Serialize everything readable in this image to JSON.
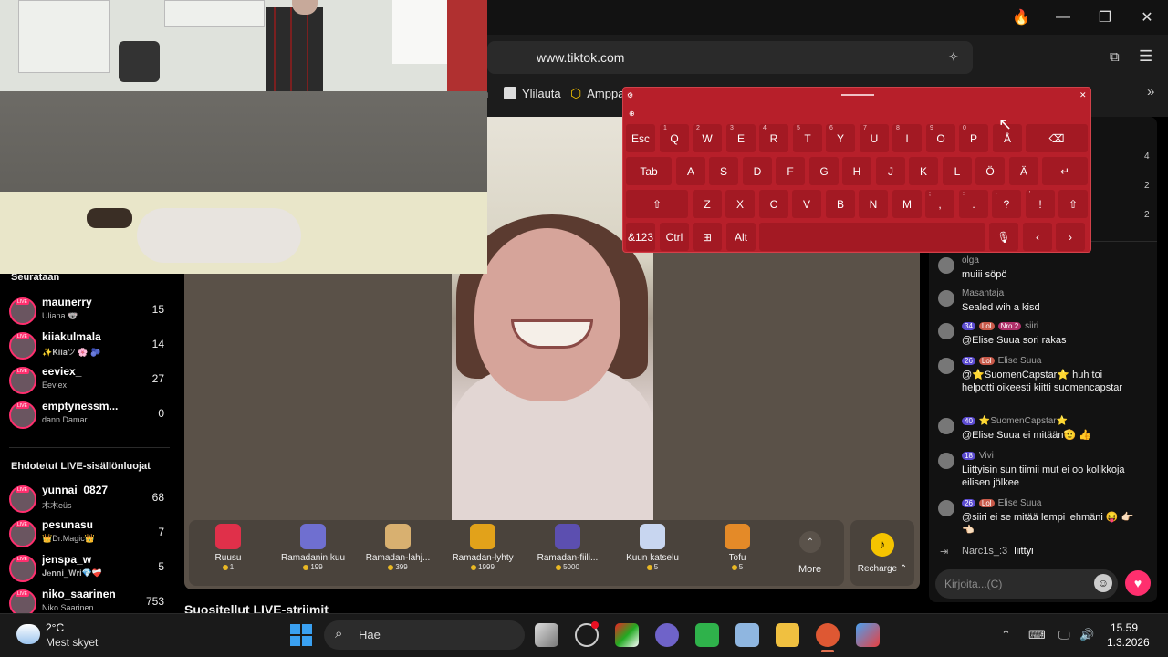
{
  "browser": {
    "url": "www.tiktok.com",
    "bookmarks": [
      {
        "label": "Ylilauta"
      },
      {
        "label": "Amppa"
      }
    ]
  },
  "sidebar": {
    "following_title": "Seurataan",
    "following": [
      {
        "name": "maunerry",
        "sub": "Uliana 🐨",
        "count": "15"
      },
      {
        "name": "kiiakulmala",
        "sub": "✨𝐊𝐢𝐢𝐚ツ 🌸 🫐",
        "count": "14"
      },
      {
        "name": "eeviex_",
        "sub": "Eeviex",
        "count": "27"
      },
      {
        "name": "emptynessm...",
        "sub": "dann Damar",
        "count": "0"
      }
    ],
    "suggested_title": "Ehdotetut LIVE-sisällönluojat",
    "suggested": [
      {
        "name": "yunnai_0827",
        "sub": "木木eüs",
        "count": "68"
      },
      {
        "name": "pesunasu",
        "sub": "👑Dr.Magic👑",
        "count": "7"
      },
      {
        "name": "jenspa_w",
        "sub": "𝐉𝐞𝐧𝐧𝐢_𝐖𝐫𝐢💎❤️‍🩹",
        "count": "5"
      },
      {
        "name": "niko_saarinen",
        "sub": "Niko Saarinen",
        "count": "753"
      }
    ]
  },
  "recommended_title": "Suositellut LIVE-striimit",
  "gifts": [
    {
      "name": "Ruusu",
      "price": "1",
      "color": "#e0304a"
    },
    {
      "name": "Ramadanin kuu",
      "price": "199",
      "color": "#6f6fd0"
    },
    {
      "name": "Ramadan-lahj...",
      "price": "399",
      "color": "#d8b070"
    },
    {
      "name": "Ramadan-lyhty",
      "price": "1999",
      "color": "#e2a21a"
    },
    {
      "name": "Ramadan-fiili...",
      "price": "5000",
      "color": "#5c4fb0"
    },
    {
      "name": "Kuun katselu",
      "price": "5",
      "color": "#c8d6f0"
    },
    {
      "name": "Tofu",
      "price": "5",
      "color": "#e48a28"
    }
  ],
  "gift_more": "More",
  "recharge": "Recharge ⌃",
  "viewer_counts": [
    "4",
    "2",
    "2"
  ],
  "chat": {
    "messages": [
      {
        "user": "olga",
        "badges": [],
        "text": "muiii söpö"
      },
      {
        "user": "Masantaja",
        "badges": [],
        "text": "Sealed wih a kisd"
      },
      {
        "user": "siiri",
        "badges": [
          "34",
          "Lol",
          "Nro 2"
        ],
        "text": "@Elise Suua sori rakas"
      },
      {
        "user": "Elise Suua",
        "badges": [
          "26",
          "Lol"
        ],
        "text": "@⭐SuomenCapstar⭐ huh toi helpotti oikeesti kiitti suomencapstar"
      },
      {
        "user": "⭐SuomenCapstar⭐",
        "badges": [
          "40"
        ],
        "text": "@Elise Suua ei mitään🫡 👍"
      },
      {
        "user": "Vivi",
        "badges": [
          "18"
        ],
        "text": "Liittyisin sun tiimii mut ei oo kolikkoja eilisen jölkee"
      },
      {
        "user": "Elise Suua",
        "badges": [
          "26",
          "Lol"
        ],
        "text": "@siiri ei se mitää lempi lehmäni 😝 👉🏻👈🏻"
      }
    ],
    "join": {
      "user": "Narc1s_:3",
      "text": "liittyi"
    },
    "placeholder": "Kirjoita...(C)"
  },
  "keyboard": {
    "row1": [
      {
        "k": "Esc"
      },
      {
        "k": "Q",
        "s": "1"
      },
      {
        "k": "W",
        "s": "2"
      },
      {
        "k": "E",
        "s": "3"
      },
      {
        "k": "R",
        "s": "4"
      },
      {
        "k": "T",
        "s": "5"
      },
      {
        "k": "Y",
        "s": "6"
      },
      {
        "k": "U",
        "s": "7"
      },
      {
        "k": "I",
        "s": "8"
      },
      {
        "k": "O",
        "s": "9"
      },
      {
        "k": "P",
        "s": "0"
      },
      {
        "k": "Å"
      },
      {
        "k": "⌫"
      }
    ],
    "row2": [
      {
        "k": "Tab"
      },
      {
        "k": "A"
      },
      {
        "k": "S"
      },
      {
        "k": "D"
      },
      {
        "k": "F"
      },
      {
        "k": "G"
      },
      {
        "k": "H"
      },
      {
        "k": "J"
      },
      {
        "k": "K"
      },
      {
        "k": "L"
      },
      {
        "k": "Ö"
      },
      {
        "k": "Ä"
      },
      {
        "k": "↵"
      }
    ],
    "row3": [
      {
        "k": "⇧"
      },
      {
        "k": "Z"
      },
      {
        "k": "X"
      },
      {
        "k": "C"
      },
      {
        "k": "V"
      },
      {
        "k": "B"
      },
      {
        "k": "N"
      },
      {
        "k": "M"
      },
      {
        "k": ",",
        "s": ";"
      },
      {
        "k": ".",
        "s": ":"
      },
      {
        "k": "?",
        "s": "-"
      },
      {
        "k": "!",
        "s": "'"
      },
      {
        "k": "⇧"
      }
    ],
    "row4": [
      {
        "k": "&123"
      },
      {
        "k": "Ctrl"
      },
      {
        "k": "⊞"
      },
      {
        "k": "Alt"
      },
      {
        "k": ""
      },
      {
        "k": "🎙"
      },
      {
        "k": "‹"
      },
      {
        "k": "›"
      }
    ]
  },
  "taskbar": {
    "weather_temp": "2°C",
    "weather_desc": "Mest skyet",
    "search_placeholder": "Hae",
    "time": "15.59",
    "date": "1.3.2026"
  },
  "colors": {
    "accent": "#ff2f6e",
    "keyboard": "#b71f2a",
    "coin": "#e9b824"
  }
}
